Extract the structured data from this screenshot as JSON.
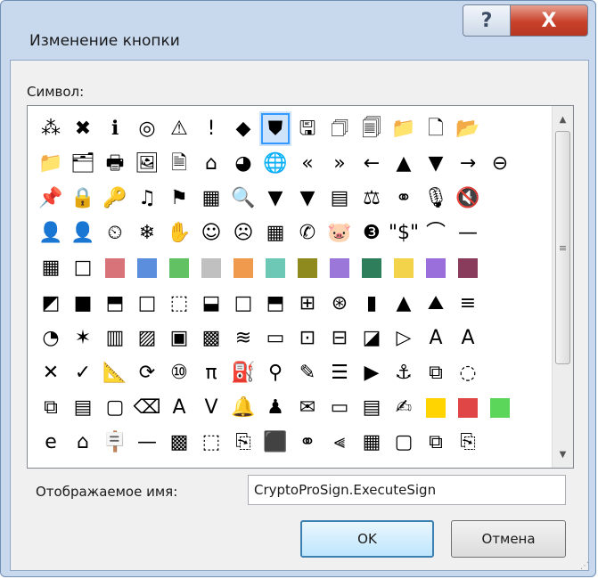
{
  "window": {
    "title": "Изменение кнопки"
  },
  "titlebar": {
    "help_label": "?",
    "close_label": "X"
  },
  "symbol_label": "Символ:",
  "selected_index": 7,
  "grid": [
    [
      "⁂",
      "✖",
      "ℹ",
      "◎",
      "⚠",
      "!",
      "◆",
      "⛊",
      "🖫",
      "🗇",
      "🗐",
      "📁",
      "🗋",
      "📂"
    ],
    [
      "📁",
      "🗂",
      "🖶",
      "🖼",
      "🗎",
      "⌂",
      "◕",
      "🌐",
      "«",
      "»",
      "←",
      "▲",
      "▼",
      "→",
      "⊖"
    ],
    [
      "📌",
      "🔒",
      "🔑",
      "♫",
      "⚑",
      "▦",
      "🔍",
      "▼",
      "▼",
      "▤",
      "⚖",
      "⚭",
      "🎙",
      "🔇"
    ],
    [
      "👤",
      "👤",
      "⏲",
      "❄",
      "✋",
      "☺",
      "☹",
      "▦",
      "✆",
      "🐷",
      "❸",
      "\"$\"",
      "⌒",
      "—"
    ],
    [
      "▦",
      "□",
      "#d9737a",
      "#5b8fde",
      "#62c263",
      "#c0c0c0",
      "#f09a4e",
      "#6ec8b6",
      "#8f8a1e",
      "#9a77d9",
      "#2e7d5b",
      "#f2d34a",
      "#9a6fdc",
      "#8a3c5c"
    ],
    [
      "◩",
      "■",
      "⬒",
      "□",
      "⬚",
      "⬓",
      "□",
      "⬒",
      "⊞",
      "⊛",
      "▮",
      "▲",
      "⛰",
      "≡"
    ],
    [
      "◔",
      "✶",
      "▥",
      "▨",
      "▣",
      "▩",
      "≋",
      "▭",
      "⊡",
      "⊟",
      "◪",
      "▷",
      "A",
      "A"
    ],
    [
      "✕",
      "✓",
      "📐",
      "⟳",
      "⑩",
      "π",
      "⛽",
      "⚲",
      "✎",
      "☰",
      "▶",
      "⚓",
      "⧉",
      "◌"
    ],
    [
      "⧉",
      "▤",
      "▢",
      "⌫",
      "A",
      "V",
      "🔔",
      "♟",
      "✉",
      "▭",
      "▤",
      "✍",
      "#ffd400",
      "#e14646",
      "#5bd65b"
    ],
    [
      "e",
      "⌂",
      "🪧",
      "—",
      "▩",
      "⬚",
      "⎘",
      "⬛",
      "⚭",
      "⫷",
      "▦",
      "▢",
      "⧉",
      "⎘"
    ]
  ],
  "name_field": {
    "label": "Отображаемое имя:",
    "value": "CryptoProSign.ExecuteSign"
  },
  "buttons": {
    "ok_label": "OK",
    "cancel_label": "Отмена"
  },
  "scrollbar": {
    "up_arrow": "▲",
    "down_arrow": "▼",
    "thumb_grip": "≡"
  }
}
